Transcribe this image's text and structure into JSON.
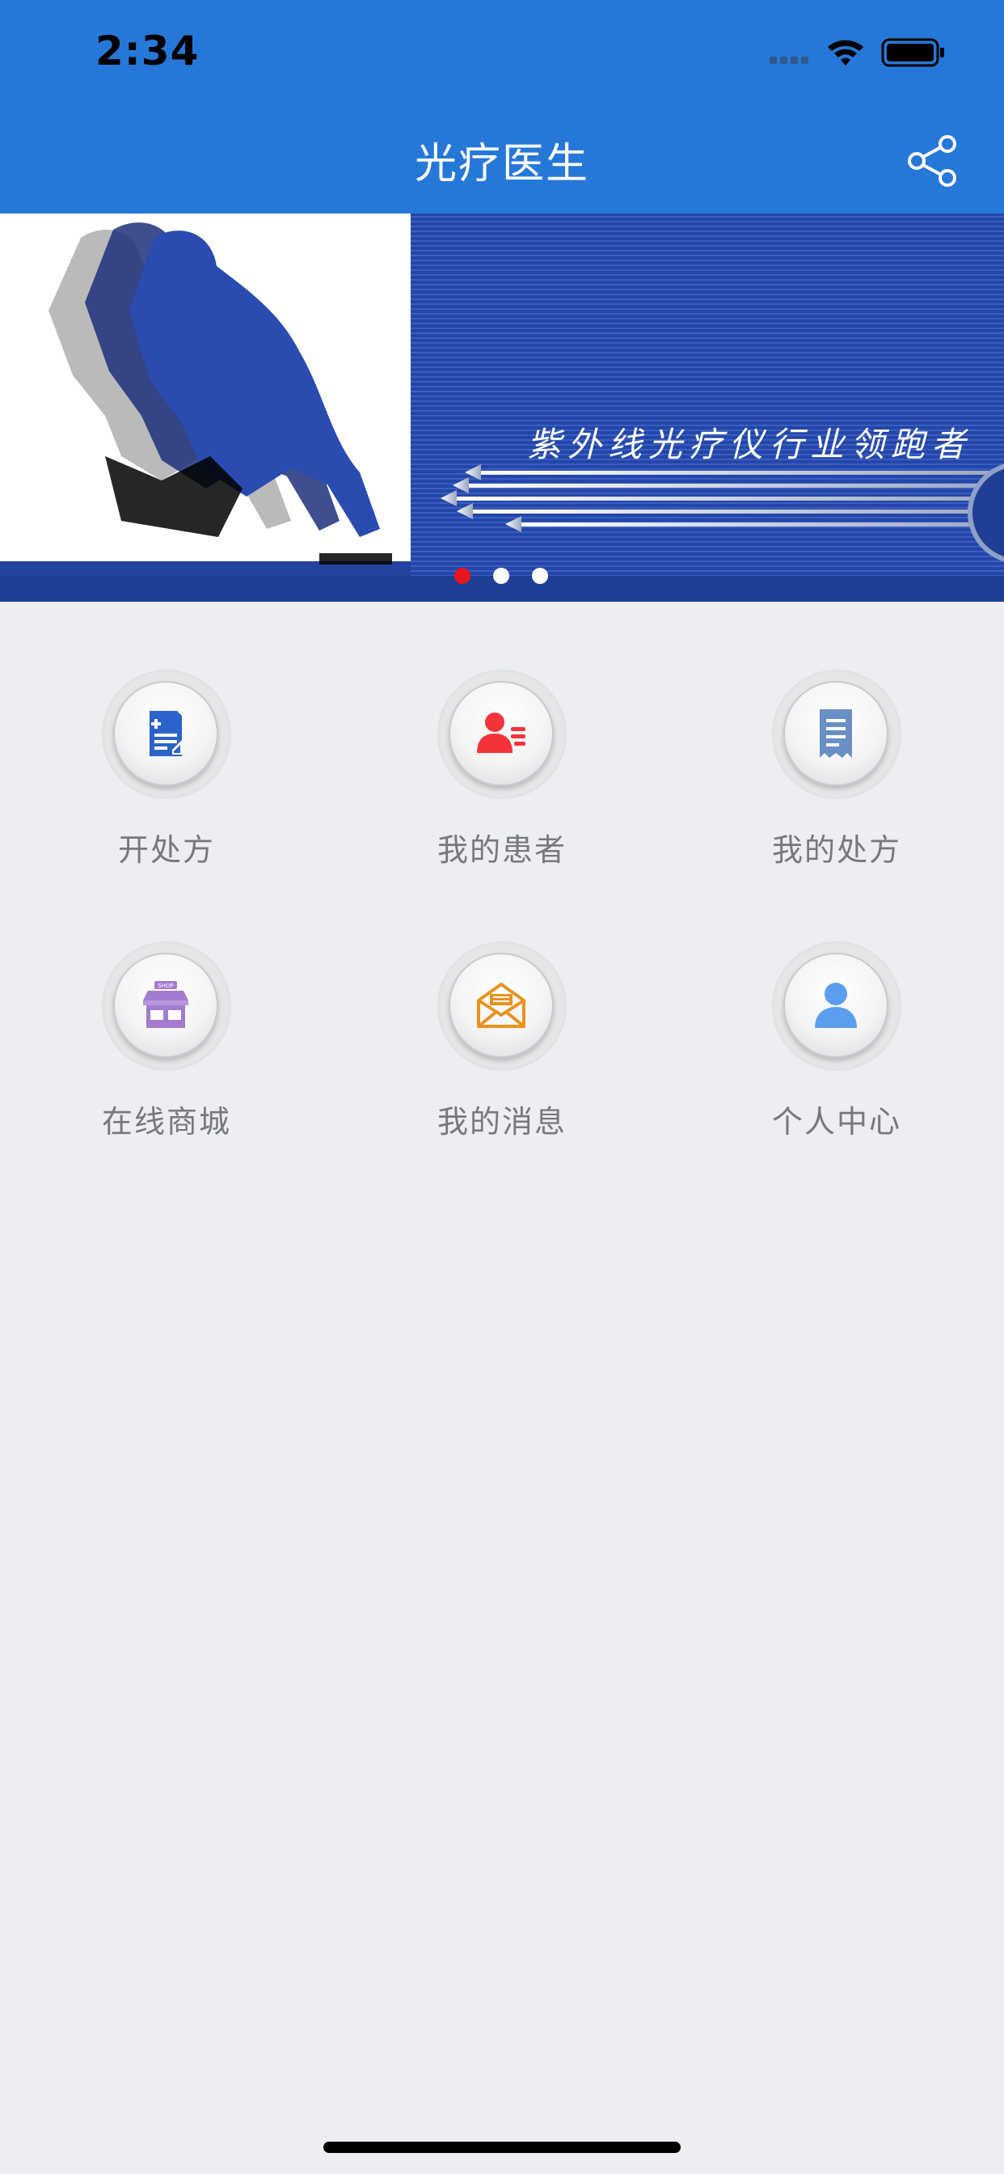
{
  "status_bar": {
    "time": "2:34"
  },
  "nav": {
    "title": "光疗医生",
    "share_icon": "share-icon"
  },
  "banner": {
    "caption": "紫外线光疗仪行业领跑者",
    "page_count": 3,
    "active_page": 1,
    "colors": {
      "background": "#1f3f9a",
      "active_dot": "#e8141f",
      "inactive_dot": "#ffffff"
    }
  },
  "menu": {
    "items": [
      {
        "label": "开处方",
        "icon": "prescription-icon",
        "color": "#2a63c9"
      },
      {
        "label": "我的患者",
        "icon": "patient-icon",
        "color": "#f2343a"
      },
      {
        "label": "我的处方",
        "icon": "receipt-icon",
        "color": "#6a8fc4"
      },
      {
        "label": "在线商城",
        "icon": "shop-icon",
        "color": "#a37bcf"
      },
      {
        "label": "我的消息",
        "icon": "message-icon",
        "color": "#e8921f"
      },
      {
        "label": "个人中心",
        "icon": "user-icon",
        "color": "#5b9ef0"
      }
    ]
  },
  "colors": {
    "header": "#2678d8",
    "background": "#eceef1",
    "label_text": "#77787b"
  }
}
